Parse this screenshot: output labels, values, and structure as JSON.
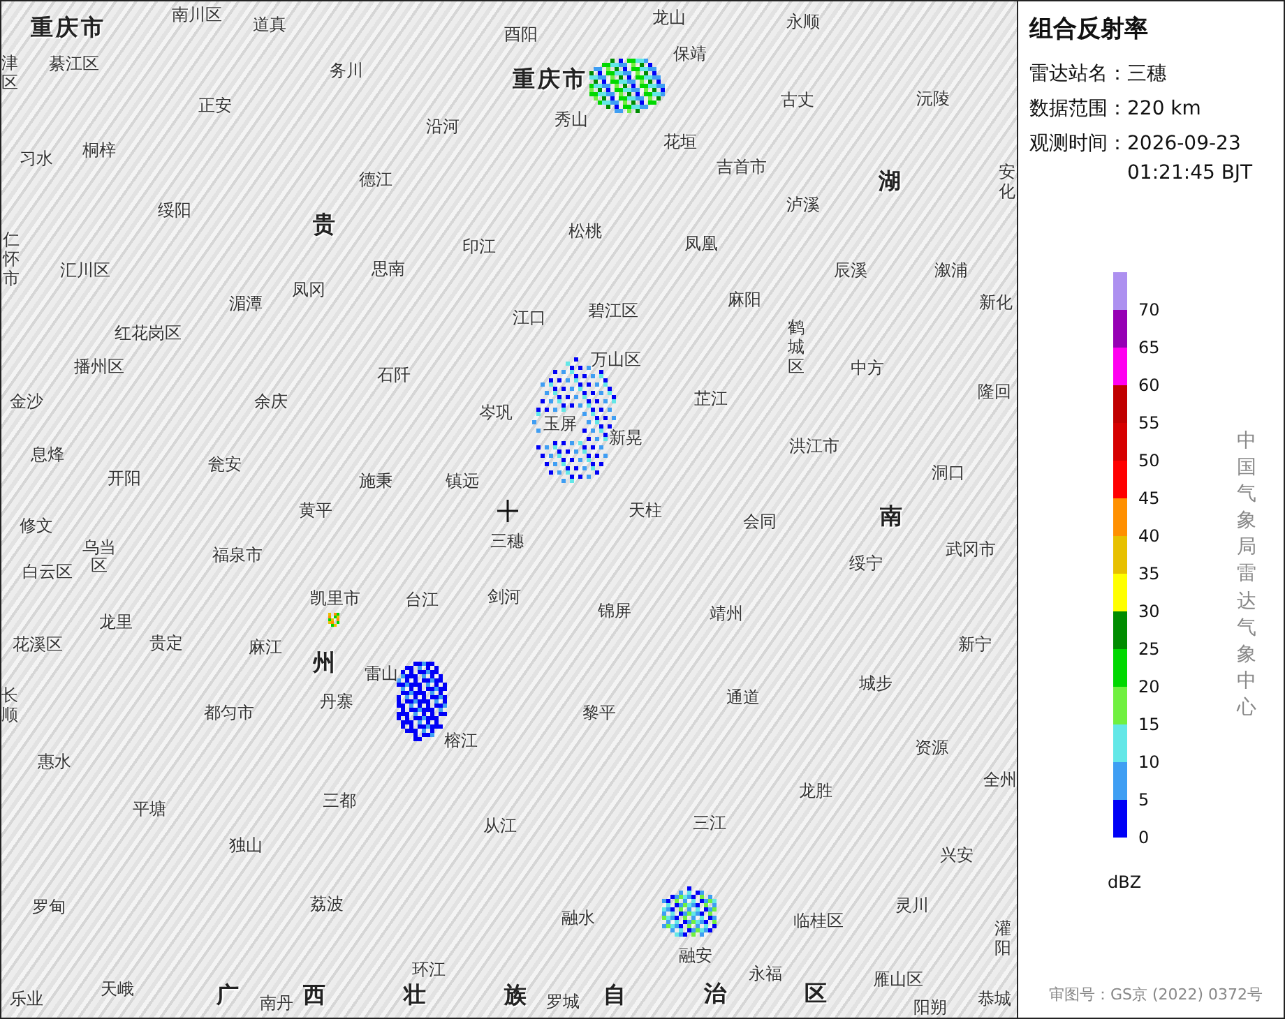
{
  "map": {
    "places": [
      {
        "text": "重庆市",
        "kind": "region"
      },
      {
        "text": "南川区",
        "kind": "city"
      },
      {
        "text": "道真",
        "kind": "city"
      },
      {
        "text": "津区",
        "kind": "vertical"
      },
      {
        "text": "綦江区",
        "kind": "city"
      },
      {
        "text": "务川",
        "kind": "city"
      },
      {
        "text": "正安",
        "kind": "city"
      },
      {
        "text": "习水",
        "kind": "city"
      },
      {
        "text": "桐梓",
        "kind": "city"
      },
      {
        "text": "绥阳",
        "kind": "city"
      },
      {
        "text": "仁怀市",
        "kind": "vertical"
      },
      {
        "text": "贵",
        "kind": "region"
      },
      {
        "text": "汇川区",
        "kind": "city"
      },
      {
        "text": "湄潭",
        "kind": "city"
      },
      {
        "text": "凤冈",
        "kind": "city"
      },
      {
        "text": "红花岗区",
        "kind": "city"
      },
      {
        "text": "播州区",
        "kind": "city"
      },
      {
        "text": "金沙",
        "kind": "city"
      },
      {
        "text": "余庆",
        "kind": "city"
      },
      {
        "text": "息烽",
        "kind": "city"
      },
      {
        "text": "开阳",
        "kind": "city"
      },
      {
        "text": "瓮安",
        "kind": "city"
      },
      {
        "text": "黄平",
        "kind": "city"
      },
      {
        "text": "酉阳",
        "kind": "city"
      },
      {
        "text": "重庆市",
        "kind": "region"
      },
      {
        "text": "龙山",
        "kind": "city"
      },
      {
        "text": "保靖",
        "kind": "city"
      },
      {
        "text": "沿河",
        "kind": "city"
      },
      {
        "text": "秀山",
        "kind": "city"
      },
      {
        "text": "德江",
        "kind": "city"
      },
      {
        "text": "花垣",
        "kind": "city"
      },
      {
        "text": "印江",
        "kind": "city"
      },
      {
        "text": "松桃",
        "kind": "city"
      },
      {
        "text": "思南",
        "kind": "city"
      },
      {
        "text": "江口",
        "kind": "city"
      },
      {
        "text": "碧江区",
        "kind": "city"
      },
      {
        "text": "石阡",
        "kind": "city"
      },
      {
        "text": "万山区",
        "kind": "city"
      },
      {
        "text": "岑巩",
        "kind": "city"
      },
      {
        "text": "玉屏",
        "kind": "city"
      },
      {
        "text": "新晃",
        "kind": "city"
      },
      {
        "text": "施秉",
        "kind": "city"
      },
      {
        "text": "镇远",
        "kind": "city"
      },
      {
        "text": "天柱",
        "kind": "city"
      },
      {
        "text": "永顺",
        "kind": "city"
      },
      {
        "text": "古丈",
        "kind": "city"
      },
      {
        "text": "沅陵",
        "kind": "city"
      },
      {
        "text": "吉首市",
        "kind": "city"
      },
      {
        "text": "湖",
        "kind": "region"
      },
      {
        "text": "泸溪",
        "kind": "city"
      },
      {
        "text": "安化",
        "kind": "vertical"
      },
      {
        "text": "凤凰",
        "kind": "city"
      },
      {
        "text": "辰溪",
        "kind": "city"
      },
      {
        "text": "溆浦",
        "kind": "city"
      },
      {
        "text": "麻阳",
        "kind": "city"
      },
      {
        "text": "新化",
        "kind": "city"
      },
      {
        "text": "鹤城区",
        "kind": "vertical"
      },
      {
        "text": "中方",
        "kind": "city"
      },
      {
        "text": "芷江",
        "kind": "city"
      },
      {
        "text": "隆回",
        "kind": "city"
      },
      {
        "text": "洪江市",
        "kind": "city"
      },
      {
        "text": "洞口",
        "kind": "city"
      },
      {
        "text": "修文",
        "kind": "city"
      },
      {
        "text": "白云区",
        "kind": "city"
      },
      {
        "text": "乌当区",
        "kind": "stacked"
      },
      {
        "text": "福泉市",
        "kind": "city"
      },
      {
        "text": "凯里市",
        "kind": "city"
      },
      {
        "text": "龙里",
        "kind": "city"
      },
      {
        "text": "花溪区",
        "kind": "city"
      },
      {
        "text": "贵定",
        "kind": "city"
      },
      {
        "text": "麻江",
        "kind": "city"
      },
      {
        "text": "州",
        "kind": "region"
      },
      {
        "text": "长顺",
        "kind": "vertical"
      },
      {
        "text": "都匀市",
        "kind": "city"
      },
      {
        "text": "丹寨",
        "kind": "city"
      },
      {
        "text": "惠水",
        "kind": "city"
      },
      {
        "text": "平塘",
        "kind": "city"
      },
      {
        "text": "三都",
        "kind": "city"
      },
      {
        "text": "独山",
        "kind": "city"
      },
      {
        "text": "罗甸",
        "kind": "city"
      },
      {
        "text": "荔波",
        "kind": "city"
      },
      {
        "text": "乐业",
        "kind": "city"
      },
      {
        "text": "天峨",
        "kind": "city"
      },
      {
        "text": "广",
        "kind": "region"
      },
      {
        "text": "南丹",
        "kind": "city"
      },
      {
        "text": "西",
        "kind": "region"
      },
      {
        "text": "三穗",
        "kind": "city"
      },
      {
        "text": "台江",
        "kind": "city"
      },
      {
        "text": "剑河",
        "kind": "city"
      },
      {
        "text": "锦屏",
        "kind": "city"
      },
      {
        "text": "雷山",
        "kind": "city"
      },
      {
        "text": "黎平",
        "kind": "city"
      },
      {
        "text": "榕江",
        "kind": "city"
      },
      {
        "text": "从江",
        "kind": "city"
      },
      {
        "text": "融水",
        "kind": "city"
      },
      {
        "text": "环江",
        "kind": "city"
      },
      {
        "text": "壮",
        "kind": "region"
      },
      {
        "text": "族",
        "kind": "region"
      },
      {
        "text": "罗城",
        "kind": "city"
      },
      {
        "text": "自",
        "kind": "region"
      },
      {
        "text": "会同",
        "kind": "city"
      },
      {
        "text": "南",
        "kind": "region"
      },
      {
        "text": "绥宁",
        "kind": "city"
      },
      {
        "text": "武冈市",
        "kind": "city"
      },
      {
        "text": "靖州",
        "kind": "city"
      },
      {
        "text": "新宁",
        "kind": "city"
      },
      {
        "text": "通道",
        "kind": "city"
      },
      {
        "text": "城步",
        "kind": "city"
      },
      {
        "text": "资源",
        "kind": "city"
      },
      {
        "text": "龙胜",
        "kind": "city"
      },
      {
        "text": "全州",
        "kind": "city"
      },
      {
        "text": "三江",
        "kind": "city"
      },
      {
        "text": "兴安",
        "kind": "city"
      },
      {
        "text": "临桂区",
        "kind": "city"
      },
      {
        "text": "灵川",
        "kind": "city"
      },
      {
        "text": "融安",
        "kind": "city"
      },
      {
        "text": "灌阳",
        "kind": "vertical"
      },
      {
        "text": "永福",
        "kind": "city"
      },
      {
        "text": "治",
        "kind": "region"
      },
      {
        "text": "区",
        "kind": "region"
      },
      {
        "text": "雁山区",
        "kind": "city"
      },
      {
        "text": "阳朔",
        "kind": "city"
      },
      {
        "text": "恭城",
        "kind": "city"
      }
    ]
  },
  "panel": {
    "title": "组合反射率",
    "fields": [
      {
        "label": "雷达站名：",
        "value": "三穗"
      },
      {
        "label": "数据范围：",
        "value": "220 km"
      },
      {
        "label": "观测时间：",
        "value": "2026-09-23 01:21:45 BJT"
      }
    ],
    "legend": [
      {
        "label": "70",
        "color": "#ad90f0"
      },
      {
        "label": "65",
        "color": "#9600b4"
      },
      {
        "label": "60",
        "color": "#ff00f0"
      },
      {
        "label": "55",
        "color": "#c00000"
      },
      {
        "label": "50",
        "color": "#d60000"
      },
      {
        "label": "45",
        "color": "#ff0000"
      },
      {
        "label": "40",
        "color": "#ff9000"
      },
      {
        "label": "35",
        "color": "#e7c000"
      },
      {
        "label": "30",
        "color": "#ffff00"
      },
      {
        "label": "25",
        "color": "#008c00"
      },
      {
        "label": "20",
        "color": "#00d800"
      },
      {
        "label": "15",
        "color": "#70f040"
      },
      {
        "label": "10",
        "color": "#63e7e7"
      },
      {
        "label": "5",
        "color": "#3f9ef3"
      },
      {
        "label": "0",
        "color": "#0000f6"
      }
    ],
    "unit": "dBZ",
    "credit": "中国气象局雷达气象中心",
    "approval": "审图号：GS京 (2022) 0372号"
  }
}
